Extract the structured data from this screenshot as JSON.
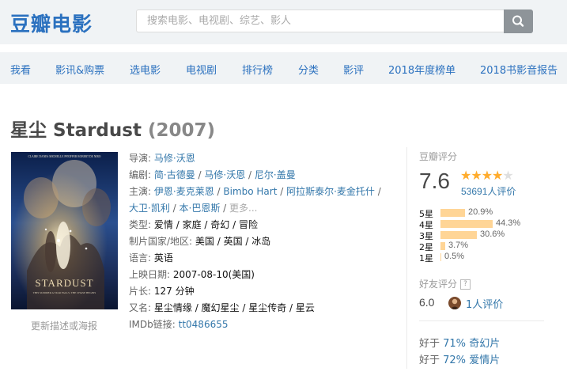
{
  "header": {
    "logo": "豆瓣电影",
    "search_placeholder": "搜索电影、电视剧、综艺、影人"
  },
  "nav": [
    "我看",
    "影讯&购票",
    "选电影",
    "电视剧",
    "排行榜",
    "分类",
    "影评",
    "2018年度榜单",
    "2018书影音报告"
  ],
  "movie": {
    "title": "星尘 Stardust",
    "year": "(2007)",
    "poster_caption": "更新描述或海报",
    "poster_text": {
      "cast_line": "CLAIRE DANES   MICHELLE PFEIFFER   ROBERT DE NIRO",
      "title": "STARDUST",
      "tagline": "THIS SUMMER A STAR FALLS. THE CHASE BEGINS"
    },
    "director_label": "导演:",
    "director": "马修·沃恩",
    "writer_label": "编剧:",
    "writers": [
      "简·古德曼",
      "马修·沃恩",
      "尼尔·盖曼"
    ],
    "cast_label": "主演:",
    "cast_line1": [
      "伊恩·麦克莱恩",
      "Bimbo Hart",
      "阿拉斯泰尔·麦金托什"
    ],
    "cast_line2": [
      "大卫·凯利",
      "本·巴恩斯"
    ],
    "cast_more": "更多...",
    "genre_label": "类型:",
    "genres": [
      "爱情",
      "家庭",
      "奇幻",
      "冒险"
    ],
    "region_label": "制片国家/地区:",
    "region": "美国 / 英国 / 冰岛",
    "language_label": "语言:",
    "language": "英语",
    "release_label": "上映日期:",
    "release": "2007-08-10(美国)",
    "runtime_label": "片长:",
    "runtime": "127 分钟",
    "aka_label": "又名:",
    "aka": "星尘情缘 / 魔幻星尘 / 星尘传奇 / 星云",
    "imdb_label": "IMDb链接:",
    "imdb": "tt0486655"
  },
  "rating": {
    "title": "豆瓣评分",
    "score": "7.6",
    "stars": 4,
    "votes": "53691人评价",
    "distribution": [
      {
        "label": "5星",
        "pct": "20.9%",
        "value": 20.9
      },
      {
        "label": "4星",
        "pct": "44.3%",
        "value": 44.3
      },
      {
        "label": "3星",
        "pct": "30.6%",
        "value": 30.6
      },
      {
        "label": "2星",
        "pct": "3.7%",
        "value": 3.7
      },
      {
        "label": "1星",
        "pct": "0.5%",
        "value": 0.5
      }
    ],
    "friend_title": "好友评分",
    "friend_help": "?",
    "friend_score": "6.0",
    "friend_count": "1人评价",
    "better_than": [
      {
        "prefix": "好于 ",
        "pct": "71%",
        "genre": "奇幻片"
      },
      {
        "prefix": "好于 ",
        "pct": "72%",
        "genre": "爱情片"
      }
    ]
  },
  "colors": {
    "brand": "#2b71bf",
    "link": "#3377aa",
    "star": "#ffac2d",
    "bar": "#ffd596"
  }
}
